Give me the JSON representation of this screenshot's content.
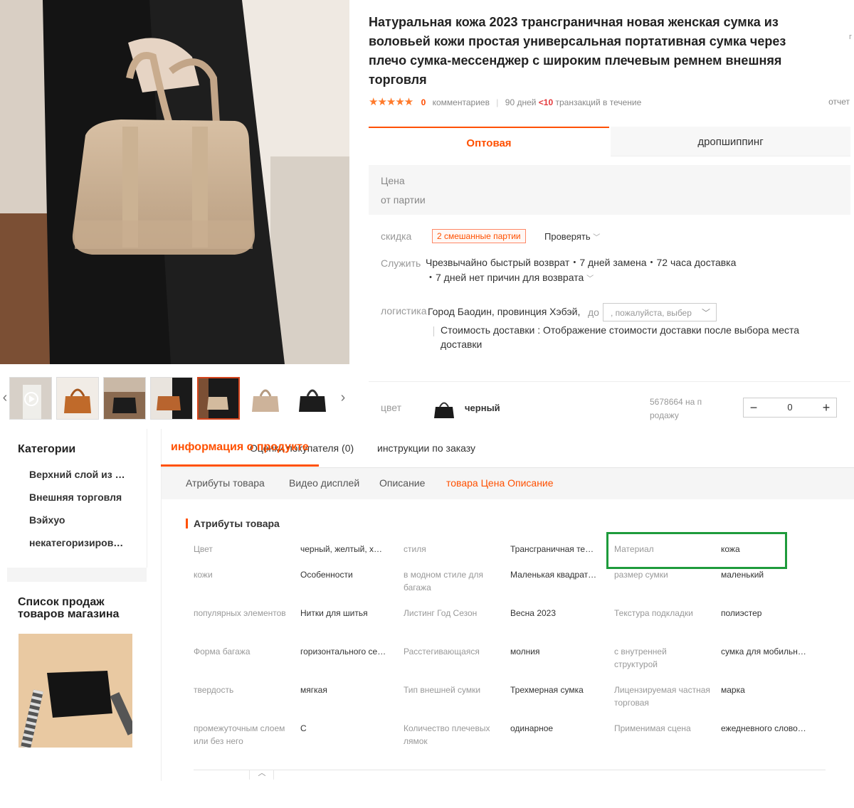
{
  "product": {
    "title": "Натуральная кожа 2023 трансграничная новая женская сумка из воловьей кожи простая универсальная портативная сумка через плечо сумка-мессенджер с широким плечевым ремнем внешняя торговля",
    "side_text": "г",
    "rating": {
      "stars": "★★★★★",
      "comment_count": "0",
      "comments_label": "комментариев",
      "days_label": "90 дней",
      "transactions_count": "<10",
      "transactions_label": "транзакций в течение",
      "report_label": "отчет"
    }
  },
  "buy_tabs": {
    "wholesale": "Оптовая",
    "dropshipping": "дропшиппинг"
  },
  "price": {
    "label": "Цена",
    "batch_label": "от партии"
  },
  "discount": {
    "label": "скидка",
    "badge": "2 смешанные партии",
    "check": "Проверять"
  },
  "service": {
    "label": "Служить",
    "line1": "Чрезвычайно быстрый возврат・7 дней замена・72 часа доставка",
    "line2": "・7 дней нет причин для возврата"
  },
  "logistics": {
    "label": "логистика",
    "from": "Город Баодин, провинция Хэбэй,",
    "to": "до",
    "select_placeholder": ", пожалуйста, выбер",
    "shipping_cost": "Стоимость доставки : Отображение стоимости доставки после выбора места доставки"
  },
  "color": {
    "label": "цвет",
    "name": "черный",
    "stock_line1": "5678664 на п",
    "stock_line2": "родажу",
    "quantity": "0",
    "minus": "−",
    "plus": "+"
  },
  "sidebar": {
    "categories_title": "Категории",
    "categories": [
      "Верхний слой из …",
      "Внешняя торговля",
      "Вэйхуо",
      "некатегоризиров…"
    ],
    "sales_title": "Список продаж товаров магазина"
  },
  "detail_tabs": {
    "info": "информация о продукте",
    "info_overlay": "Оценки покупателя (0)",
    "instructions": "инструкции по заказу"
  },
  "subnav": [
    "Атрибуты товара",
    "Видео дисплей",
    "Описание",
    "товара Цена Описание"
  ],
  "attributes": {
    "title": "Атрибуты товара",
    "rows": [
      [
        [
          "Цвет",
          "черный, желтый, х…"
        ],
        [
          "стиля",
          "Трансграничная те…"
        ],
        [
          "Материал",
          "кожа"
        ]
      ],
      [
        [
          "кожи",
          "Особенности"
        ],
        [
          "в модном стиле для багажа",
          "Маленькая квадрат…"
        ],
        [
          "размер сумки",
          "маленький"
        ]
      ],
      [
        [
          "популярных элементов",
          "Нитки для шитья"
        ],
        [
          "Листинг Год Сезон",
          "Весна 2023"
        ],
        [
          "Текстура подкладки",
          "полиэстер"
        ]
      ],
      [
        [
          "Форма багажа",
          "горизонтального се…"
        ],
        [
          "Расстегивающаяся",
          "молния"
        ],
        [
          "с внутренней структурой",
          "сумка для мобильн…"
        ]
      ],
      [
        [
          "твердость",
          "мягкая"
        ],
        [
          "Тип внешней сумки",
          "Трехмерная сумка"
        ],
        [
          "Лицензируемая частная торговая",
          "марка"
        ]
      ],
      [
        [
          "промежуточным слоем или без него",
          "С"
        ],
        [
          "Количество плечевых лямок",
          "одинарное"
        ],
        [
          "Применимая сцена",
          "ежедневного слово…"
        ]
      ]
    ]
  },
  "colors": {
    "accent": "#ff5000",
    "highlight": "#1e9b3c"
  }
}
